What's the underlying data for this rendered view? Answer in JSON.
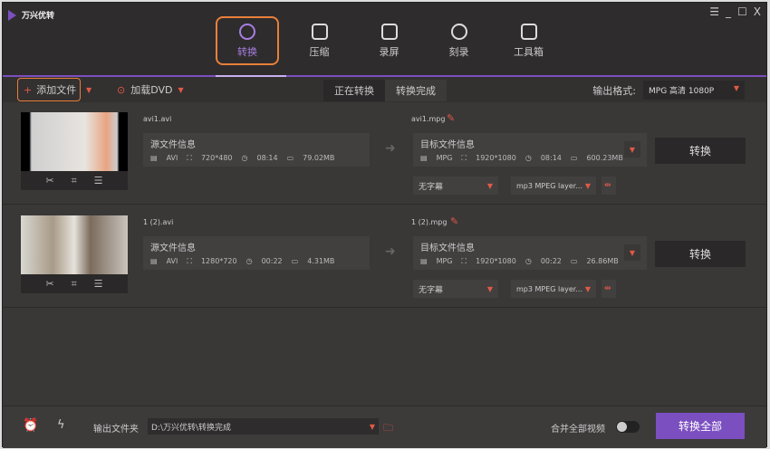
{
  "app": {
    "title": "万兴优转",
    "window_controls": [
      "☰",
      "_",
      "☐",
      "X"
    ]
  },
  "nav": [
    {
      "label": "转换",
      "icon": "convert-icon",
      "active": true
    },
    {
      "label": "压缩",
      "icon": "compress-icon"
    },
    {
      "label": "录屏",
      "icon": "record-icon"
    },
    {
      "label": "刻录",
      "icon": "burn-icon"
    },
    {
      "label": "工具箱",
      "icon": "toolbox-icon"
    }
  ],
  "toolbar": {
    "add_file": "添加文件",
    "load_dvd": "加载DVD",
    "tab_converting": "正在转换",
    "tab_done": "转换完成",
    "output_format_label": "输出格式:",
    "output_format": "MPG 高清 1080P"
  },
  "files": [
    {
      "src_name": "avi1.avi",
      "src_title": "源文件信息",
      "src": {
        "format": "AVI",
        "res": "720*480",
        "dur": "08:14",
        "size": "79.02MB"
      },
      "dst_name": "avi1.mpg",
      "dst_title": "目标文件信息",
      "dst": {
        "format": "MPG",
        "res": "1920*1080",
        "dur": "08:14",
        "size": "600.23MB"
      },
      "subtitle": "无字幕",
      "audio": "mp3 MPEG layer...",
      "convert": "转换"
    },
    {
      "src_name": "1 (2).avi",
      "src_title": "源文件信息",
      "src": {
        "format": "AVI",
        "res": "1280*720",
        "dur": "00:22",
        "size": "4.31MB"
      },
      "dst_name": "1 (2).mpg",
      "dst_title": "目标文件信息",
      "dst": {
        "format": "MPG",
        "res": "1920*1080",
        "dur": "00:22",
        "size": "26.86MB"
      },
      "subtitle": "无字幕",
      "audio": "mp3 MPEG layer...",
      "convert": "转换"
    }
  ],
  "footer": {
    "output_folder_label": "输出文件夹",
    "output_path": "D:\\万兴优转\\转换完成",
    "merge_label": "合并全部视频",
    "merge_on": false,
    "convert_all": "转换全部"
  },
  "colors": {
    "accent": "#7b4fc0",
    "highlight": "#e8803a",
    "red": "#e05a45"
  }
}
